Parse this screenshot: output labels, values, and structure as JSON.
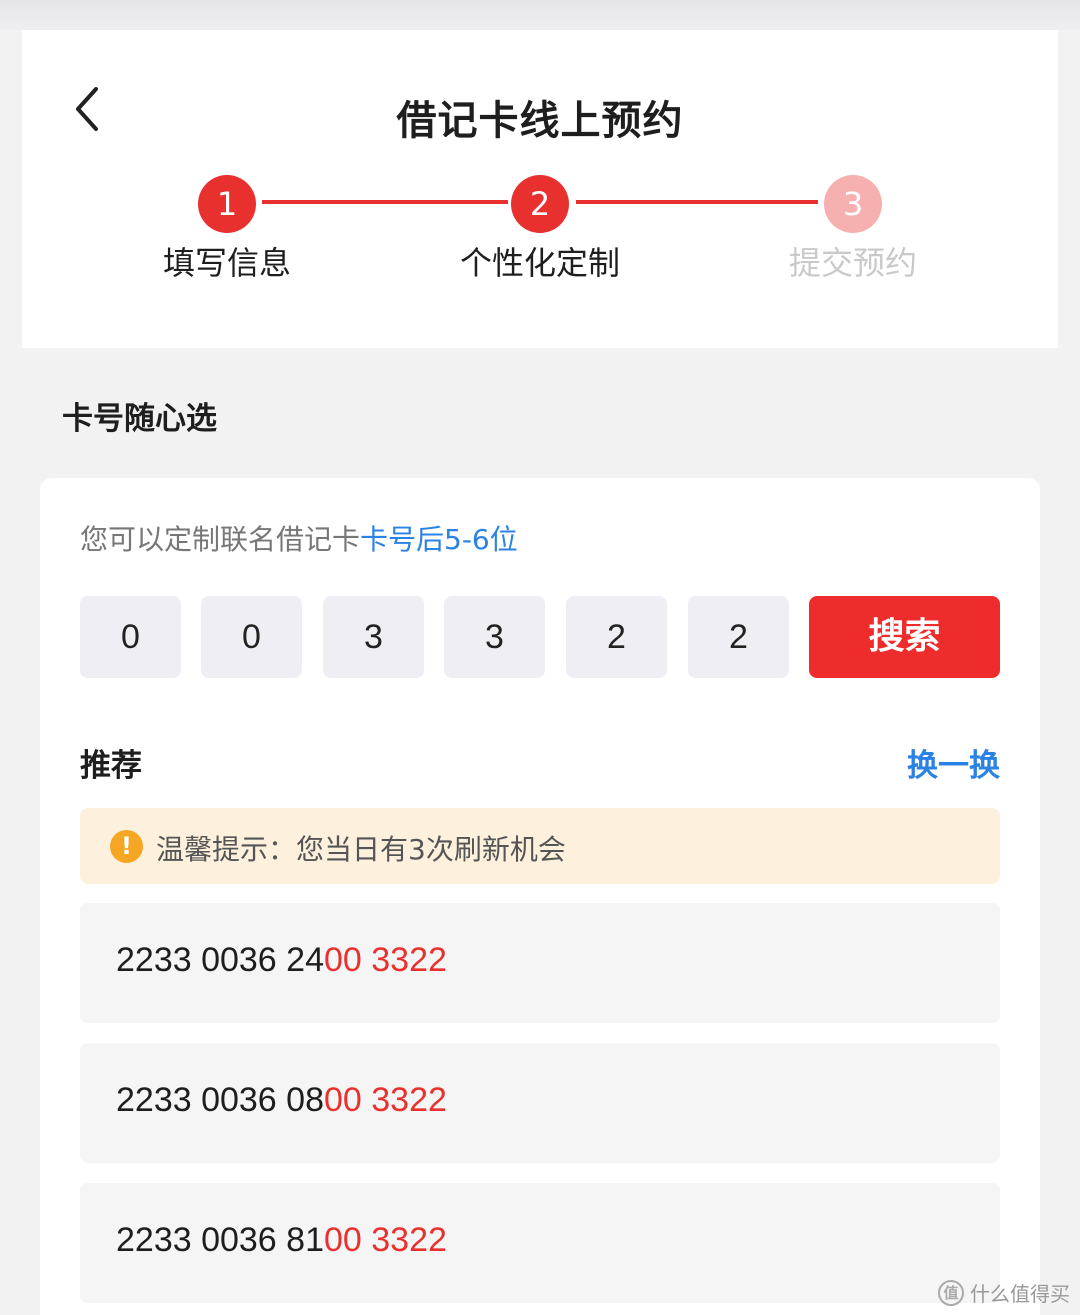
{
  "header": {
    "title": "借记卡线上预约"
  },
  "steps": [
    {
      "number": "1",
      "label": "填写信息",
      "state": "done"
    },
    {
      "number": "2",
      "label": "个性化定制",
      "state": "active"
    },
    {
      "number": "3",
      "label": "提交预约",
      "state": "pending"
    }
  ],
  "section": {
    "title": "卡号随心选"
  },
  "card": {
    "hint_prefix": "您可以定制联名借记卡",
    "hint_highlight": "卡号后5-6位",
    "digits": [
      "0",
      "0",
      "3",
      "3",
      "2",
      "2"
    ],
    "search_label": "搜索"
  },
  "recommend": {
    "title": "推荐",
    "refresh_label": "换一换",
    "tip_text": "温馨提示：您当日有3次刷新机会",
    "numbers": [
      {
        "normal": "2233 0036 24",
        "highlight": "00 3322"
      },
      {
        "normal": "2233 0036 08",
        "highlight": "00 3322"
      },
      {
        "normal": "2233 0036 81",
        "highlight": "00 3322"
      }
    ]
  },
  "watermark": {
    "text": "什么值得买"
  },
  "colors": {
    "accent_red": "#e8312f",
    "link_blue": "#2a82e4",
    "step_pending": "#f6b0b0",
    "tip_bg": "#fdf1dd",
    "tip_icon": "#f5a623"
  }
}
